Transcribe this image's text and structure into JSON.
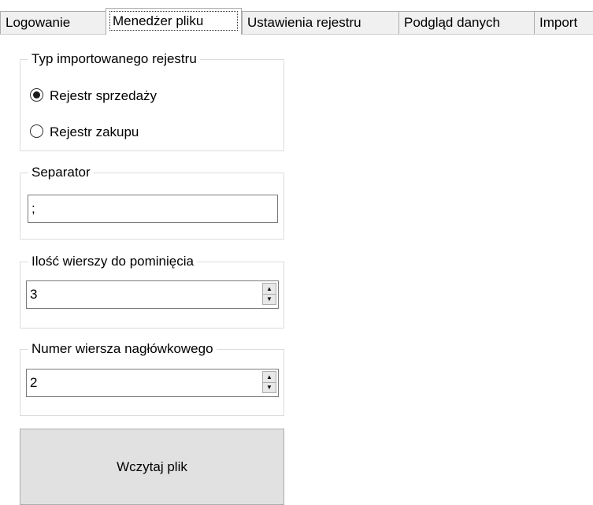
{
  "tabs": [
    {
      "label": "Logowanie"
    },
    {
      "label": "Menedżer pliku"
    },
    {
      "label": "Ustawienia rejestru"
    },
    {
      "label": "Podgląd danych"
    },
    {
      "label": "Import"
    }
  ],
  "register_type": {
    "legend": "Typ importowanego rejestru",
    "options": [
      {
        "label": "Rejestr sprzedaży",
        "checked": true
      },
      {
        "label": "Rejestr zakupu",
        "checked": false
      }
    ]
  },
  "separator": {
    "legend": "Separator",
    "value": ";"
  },
  "skip_rows": {
    "legend": "Ilość wierszy do pominięcia",
    "value": "3"
  },
  "header_row": {
    "legend": "Numer wiersza nagłówkowego",
    "value": "2"
  },
  "load_button": {
    "label": "Wczytaj plik"
  }
}
